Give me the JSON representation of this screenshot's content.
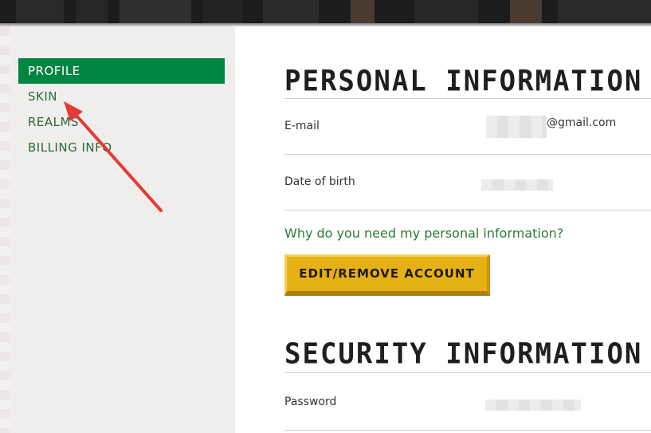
{
  "sidebar": {
    "items": [
      {
        "label": "PROFILE",
        "active": true
      },
      {
        "label": "SKIN",
        "active": false
      },
      {
        "label": "REALMS",
        "active": false
      },
      {
        "label": "BILLING INFO",
        "active": false
      }
    ]
  },
  "personal": {
    "title": "PERSONAL INFORMATION",
    "email_label": "E-mail",
    "email_suffix": "@gmail.com",
    "dob_label": "Date of birth",
    "why_link": "Why do you need my personal information?",
    "edit_button": "EDIT/REMOVE ACCOUNT"
  },
  "security": {
    "title": "SECURITY INFORMATION",
    "password_label": "Password"
  },
  "colors": {
    "active_nav": "#008542",
    "link_green": "#2b7a3a",
    "button_gold": "#e6b112",
    "annotation_red": "#e53935"
  },
  "annotation": {
    "icon": "red-arrow-pointing-at-skin"
  }
}
